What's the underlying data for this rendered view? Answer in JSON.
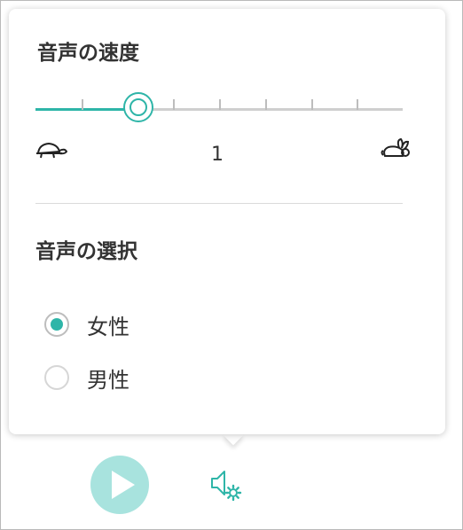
{
  "speed": {
    "title": "音声の速度",
    "value_label": "1",
    "slider_level": 0.25,
    "tick_count": 9,
    "slow_icon": "turtle-icon",
    "fast_icon": "rabbit-icon"
  },
  "voice": {
    "title": "音声の選択",
    "options": [
      {
        "label": "女性",
        "selected": true
      },
      {
        "label": "男性",
        "selected": false
      }
    ]
  },
  "controls": {
    "play_icon": "play-icon",
    "settings_icon": "speaker-gear-icon"
  },
  "colors": {
    "accent": "#2eb5a8",
    "play_button_bg": "#a8e3de",
    "track": "#cfcfcf",
    "text": "#333333"
  }
}
